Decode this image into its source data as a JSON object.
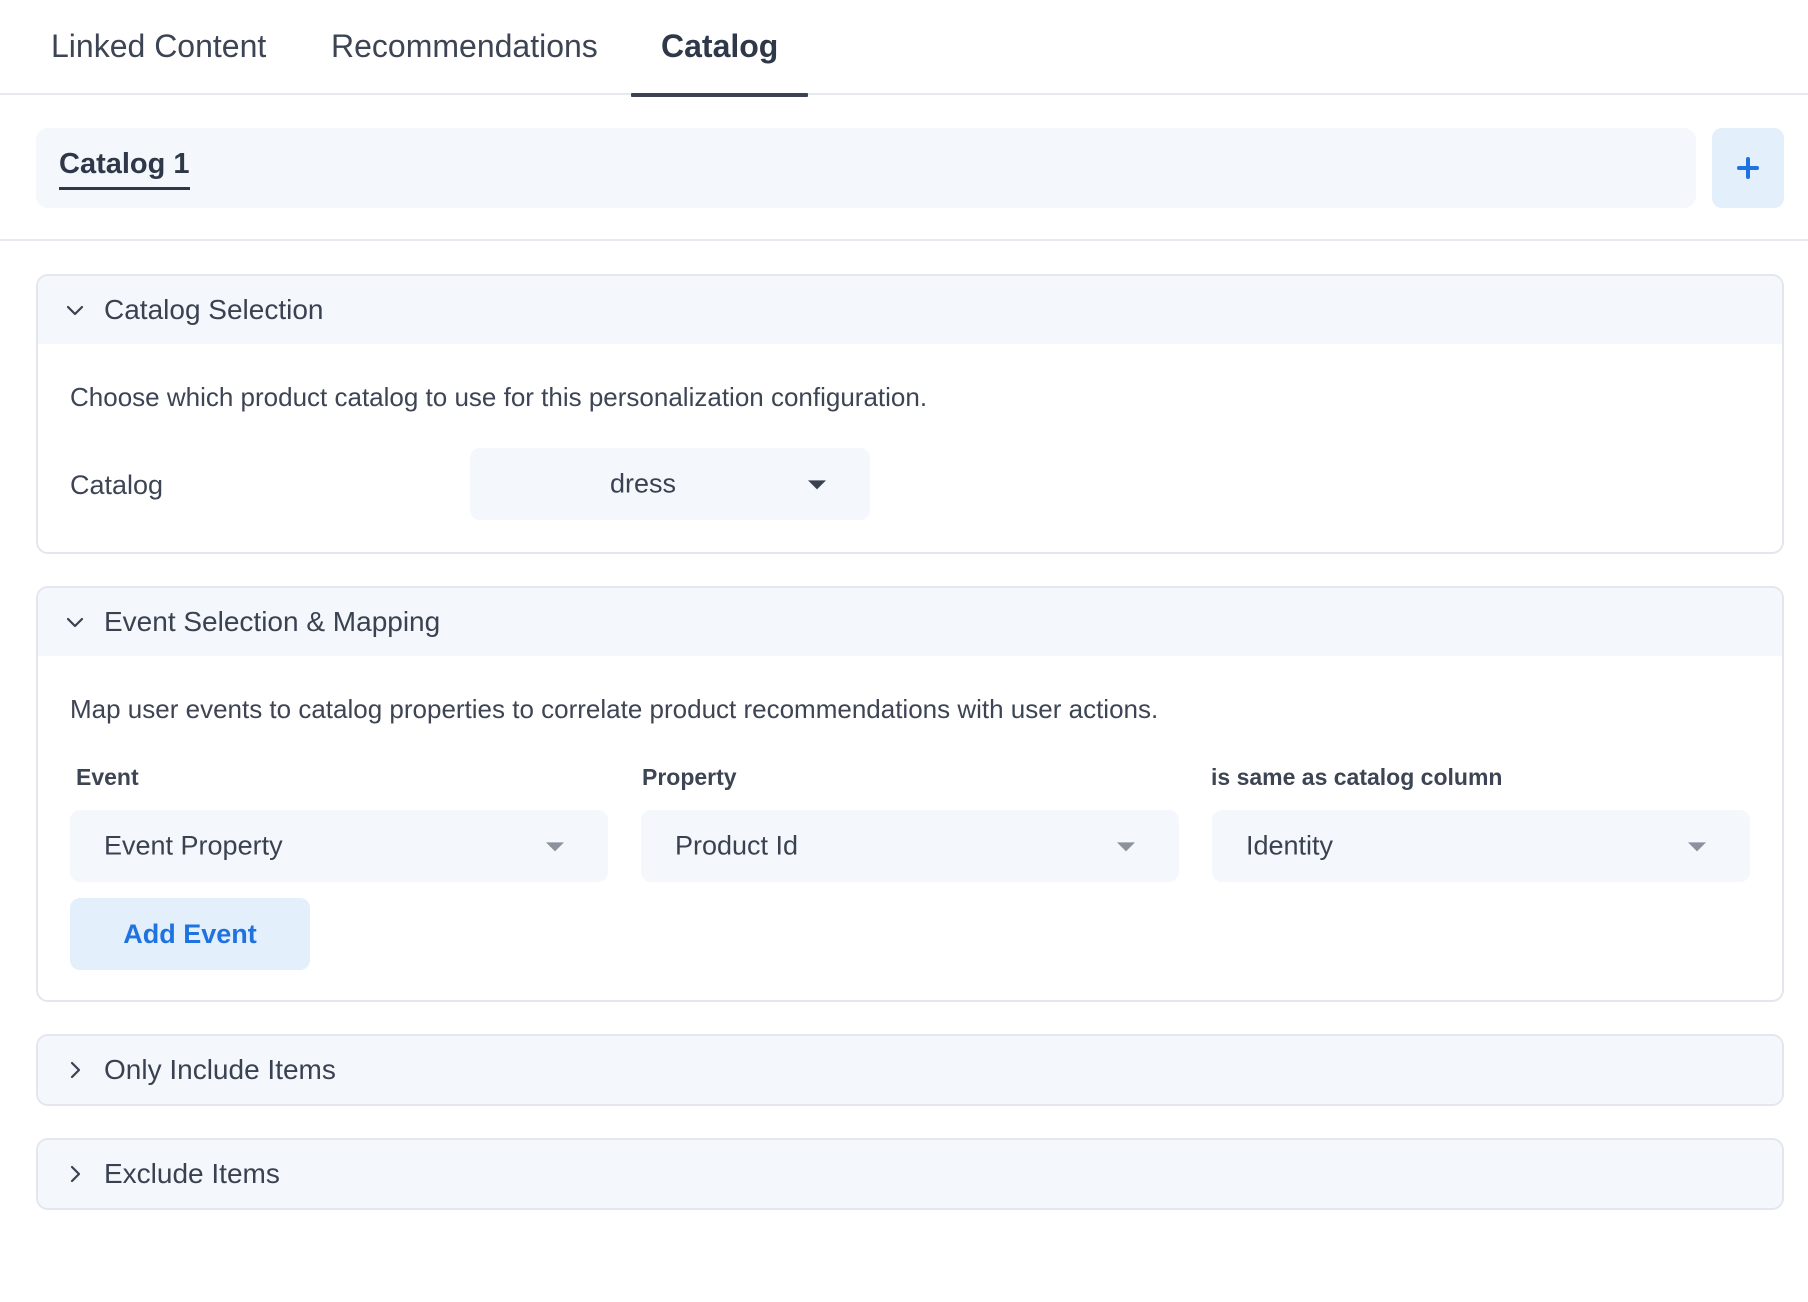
{
  "tabs": [
    {
      "label": "Linked Content",
      "active": false
    },
    {
      "label": "Recommendations",
      "active": false
    },
    {
      "label": "Catalog",
      "active": true
    }
  ],
  "catalog_bar": {
    "active_catalog": "Catalog 1",
    "add_icon": "plus-icon"
  },
  "sections": {
    "catalog_selection": {
      "title": "Catalog Selection",
      "expanded": true,
      "description": "Choose which product catalog to use for this personalization configuration.",
      "catalog_label": "Catalog",
      "catalog_value": "dress"
    },
    "event_mapping": {
      "title": "Event Selection & Mapping",
      "expanded": true,
      "description": "Map user events to catalog properties to correlate product recommendations with user actions.",
      "columns": [
        "Event",
        "Property",
        "is same as catalog column"
      ],
      "row": {
        "event": "Event Property",
        "property": "Product Id",
        "catalog_column": "Identity"
      },
      "add_event_label": "Add Event"
    },
    "include_items": {
      "title": "Only Include Items",
      "expanded": false
    },
    "exclude_items": {
      "title": "Exclude Items",
      "expanded": false
    }
  },
  "colors": {
    "accent": "#1f73e0",
    "panel_bg": "#f4f7fb",
    "button_bg": "#e4effc",
    "text": "#3a4252"
  }
}
